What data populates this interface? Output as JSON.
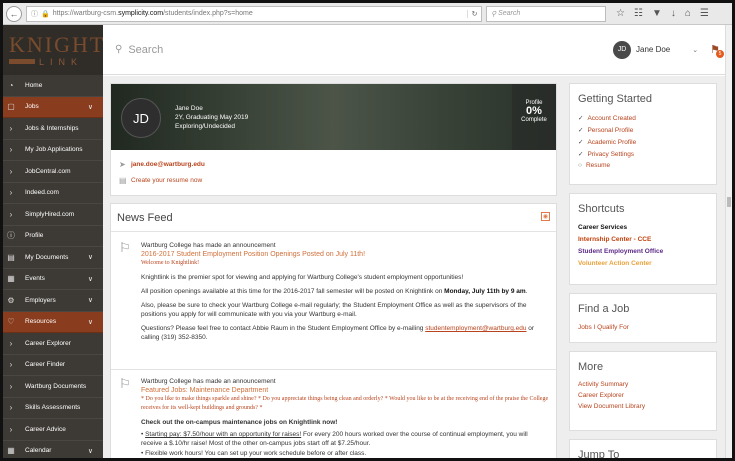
{
  "browser": {
    "url_prefix": "https://wartburg-csm.",
    "url_host": "symplicity.com",
    "url_path": "/students/index.php?s=home",
    "search_placeholder": "Search"
  },
  "app": {
    "logo_title": "KNIGHT",
    "logo_sub": "LINK"
  },
  "sidebar": {
    "items": [
      {
        "label": "Home",
        "icon": "speedometer-icon",
        "section": false,
        "chevron": false
      },
      {
        "label": "Jobs",
        "icon": "briefcase-icon",
        "section": true,
        "chevron": true
      },
      {
        "label": "Jobs & Internships",
        "icon": "chevron-right-icon",
        "section": false,
        "chevron": false
      },
      {
        "label": "My Job Applications",
        "icon": "chevron-right-icon",
        "section": false,
        "chevron": false
      },
      {
        "label": "JobCentral.com",
        "icon": "chevron-right-icon",
        "section": false,
        "chevron": false
      },
      {
        "label": "Indeed.com",
        "icon": "chevron-right-icon",
        "section": false,
        "chevron": false
      },
      {
        "label": "SimplyHired.com",
        "icon": "chevron-right-icon",
        "section": false,
        "chevron": false
      },
      {
        "label": "Profile",
        "icon": "info-icon",
        "section": false,
        "chevron": false
      },
      {
        "label": "My Documents",
        "icon": "document-icon",
        "section": false,
        "chevron": true
      },
      {
        "label": "Events",
        "icon": "calendar-icon",
        "section": false,
        "chevron": true
      },
      {
        "label": "Employers",
        "icon": "gears-icon",
        "section": false,
        "chevron": true
      },
      {
        "label": "Resources",
        "icon": "bulb-icon",
        "section": true,
        "chevron": true
      },
      {
        "label": "Career Explorer",
        "icon": "chevron-right-icon",
        "section": false,
        "chevron": false
      },
      {
        "label": "Career Finder",
        "icon": "chevron-right-icon",
        "section": false,
        "chevron": false
      },
      {
        "label": "Wartburg Documents",
        "icon": "chevron-right-icon",
        "section": false,
        "chevron": false
      },
      {
        "label": "Skills Assessments",
        "icon": "chevron-right-icon",
        "section": false,
        "chevron": false
      },
      {
        "label": "Career Advice",
        "icon": "chevron-right-icon",
        "section": false,
        "chevron": false
      },
      {
        "label": "Calendar",
        "icon": "calendar-icon",
        "section": false,
        "chevron": true
      }
    ]
  },
  "header": {
    "search_placeholder": "Search",
    "user_initials": "JD",
    "user_name": "Jane Doe",
    "notification_count": "5"
  },
  "profile": {
    "initials": "JD",
    "name": "Jane Doe",
    "line1": "2Y, Graduating May 2019",
    "line2": "Exploring/Undecided",
    "progress_label": "Profile",
    "progress_value": "0%",
    "progress_sub": "Complete",
    "email": "jane.doe@wartburg.edu",
    "resume_link": "Create your resume now"
  },
  "news": {
    "title": "News Feed",
    "items": [
      {
        "head": "Wartburg College has made an announcement",
        "title": "2016-2017 Student Employment Position Openings Posted on July 11th!",
        "sub": "Welcome to Knightlink!",
        "p1": "Knightlink is the premier spot for viewing and applying for Wartburg College's student employment opportunities!",
        "p2a": "All position openings available at this time for the 2016-2017 fall semester will be posted on Knightlink on ",
        "p2b": "Monday, July 11th by 9 am",
        "p2c": ".",
        "p3": "Also, please be sure to check your Wartburg College e-mail regularly; the Student Employment Office as well as the supervisors of the positions you apply for will communicate with you via your Wartburg e-mail.",
        "p4a": "Questions? Please feel free to contact Abbie Raum in the Student Employment Office by e-mailing ",
        "p4mail": "studentemployment@wartburg.edu",
        "p4b": " or calling (319) 352-8350."
      },
      {
        "head": "Wartburg College has made an announcement",
        "title": "Featured Jobs: Maintenance Department",
        "sub": "* Do you like to make things sparkle and shine? * Do you appreciate things being clean and orderly? * Would you like to be at the receiving end of the praise the College receives for its well-kept buildings and grounds? *",
        "p1": "Check out the on-campus maintenance jobs on Knightlink now!",
        "b1a": "Starting pay: $7.50/hour with an opportunity for raises!",
        "b1b": " For every 200 hours worked over the course of continual employment, you will receive a $.10/hr raise! Most of the other on-campus jobs start off at $7.25/hour.",
        "b2": "Flexible work hours! You can set up your work schedule before or after class."
      }
    ]
  },
  "getting_started": {
    "title": "Getting Started",
    "items": [
      {
        "label": "Account Created",
        "done": true
      },
      {
        "label": "Personal Profile",
        "done": true
      },
      {
        "label": "Academic Profile",
        "done": true
      },
      {
        "label": "Privacy Settings",
        "done": true
      },
      {
        "label": "Resume",
        "done": false
      }
    ]
  },
  "shortcuts": {
    "title": "Shortcuts",
    "items": [
      {
        "label": "Career Services",
        "color": "#111111"
      },
      {
        "label": "Internship Center - CCE",
        "color": "#c2410c"
      },
      {
        "label": "Student Employment Office",
        "color": "#5b2a86"
      },
      {
        "label": "Volunteer Action Center",
        "color": "#e8a23a"
      }
    ]
  },
  "find_job": {
    "title": "Find a Job",
    "link": "Jobs I Qualify For"
  },
  "more": {
    "title": "More",
    "items": [
      "Activity Summary",
      "Career Explorer",
      "View Document Library"
    ]
  },
  "jump_to": {
    "title": "Jump To"
  }
}
